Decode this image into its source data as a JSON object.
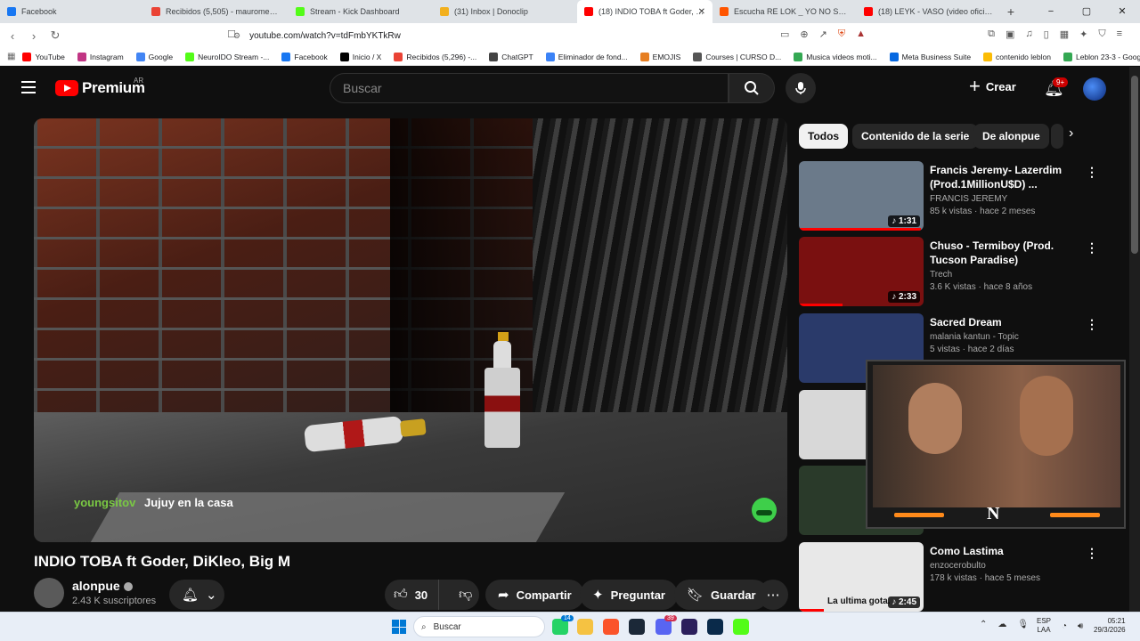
{
  "browser": {
    "tabs": [
      {
        "title": "Facebook",
        "color": "#1877f2"
      },
      {
        "title": "Recibidos (5,505) - mauromedinatuc",
        "color": "#ea4335"
      },
      {
        "title": "Stream - Kick Dashboard",
        "color": "#53fc18"
      },
      {
        "title": "(31) Inbox | Donoclip",
        "color": "#f2b01e"
      },
      {
        "title": "(18) INDIO TOBA ft Goder, DiKle",
        "color": "#ff0000",
        "active": true
      },
      {
        "title": "Escucha RE LOK _ YO NO SOY UN G",
        "color": "#ff5500"
      },
      {
        "title": "(18) LEYK - VASO (video oficial) - Yo",
        "color": "#ff0000"
      }
    ],
    "new_tab": "+",
    "window_controls": [
      "−",
      "▢",
      "✕"
    ],
    "url": "youtube.com/watch?v=tdFmbYKTkRw",
    "bookmarks": [
      {
        "label": "YouTube",
        "color": "#ff0000"
      },
      {
        "label": "Instagram",
        "color": "#c13584"
      },
      {
        "label": "Google",
        "color": "#4285f4"
      },
      {
        "label": "NeuroIDO Stream -...",
        "color": "#53fc18"
      },
      {
        "label": "Facebook",
        "color": "#1877f2"
      },
      {
        "label": "Inicio / X",
        "color": "#000000"
      },
      {
        "label": "Recibidos (5,296) -...",
        "color": "#ea4335"
      },
      {
        "label": "ChatGPT",
        "color": "#444444"
      },
      {
        "label": "Eliminador de fond...",
        "color": "#3b82f6"
      },
      {
        "label": "EMOJIS",
        "color": "#e67e22"
      },
      {
        "label": "Courses | CURSO D...",
        "color": "#555555"
      },
      {
        "label": "Musica videos moti...",
        "color": "#34a853"
      },
      {
        "label": "Meta Business Suite",
        "color": "#0668e1"
      },
      {
        "label": "contenido leblon",
        "color": "#fbbc05"
      },
      {
        "label": "Leblon 23-3 - Googl...",
        "color": "#34a853"
      }
    ]
  },
  "youtube": {
    "logo_text": "Premium",
    "country": "AR",
    "search_placeholder": "Buscar",
    "create_label": "Crear",
    "notif_badge": "9+"
  },
  "video": {
    "title": "INDIO TOBA ft Goder, DiKleo, Big M",
    "chat_user": "youngsitov",
    "chat_message": "Jujuy en la casa",
    "channel": "alonpue",
    "subscribers": "2.43 K suscriptores",
    "likes": "30",
    "share_label": "Compartir",
    "ask_label": "Preguntar",
    "save_label": "Guardar"
  },
  "chips": [
    "Todos",
    "Contenido de la serie",
    "De alonpue"
  ],
  "recommendations": [
    {
      "title": "Francis Jeremy- Lazerdim (Prod.1MillionU$D) ...",
      "channel": "FRANCIS JEREMY",
      "views": "85 k vistas · hace 2 meses",
      "duration": "1:31",
      "music": true,
      "thumb": "#6b7a8a",
      "progress": 0.98
    },
    {
      "title": "Chuso - Termiboy (Prod. Tucson Paradise)",
      "channel": "Trech",
      "views": "3.6 K vistas · hace 8 años",
      "duration": "2:33",
      "music": true,
      "thumb": "#7a1010",
      "progress": 0.35
    },
    {
      "title": "Sacred Dream",
      "channel": "malania kantun - Topic",
      "views": "5 vistas · hace 2 días",
      "duration": "",
      "music": false,
      "thumb": "#2a3a6a",
      "progress": 0
    },
    {
      "title": "",
      "channel": "",
      "views": "",
      "duration": "",
      "music": false,
      "thumb": "#d8d8d8",
      "progress": 0
    },
    {
      "title": "",
      "channel": "",
      "views": "",
      "duration": "",
      "music": false,
      "thumb": "#2a3a2a",
      "progress": 0
    },
    {
      "title": "Como Lastima",
      "channel": "enzocerobulto",
      "views": "178 k vistas · hace 5 meses",
      "duration": "2:45",
      "music": true,
      "thumb": "#e8e8e8",
      "thumb_caption": "La ultima gota.",
      "progress": 0.2
    }
  ],
  "taskbar": {
    "search_placeholder": "Buscar",
    "lang_top": "ESP",
    "lang_bottom": "LAA",
    "time": "05:21",
    "date": "29/3/2026",
    "badge_whatsapp": "14",
    "badge_discord": "39"
  }
}
